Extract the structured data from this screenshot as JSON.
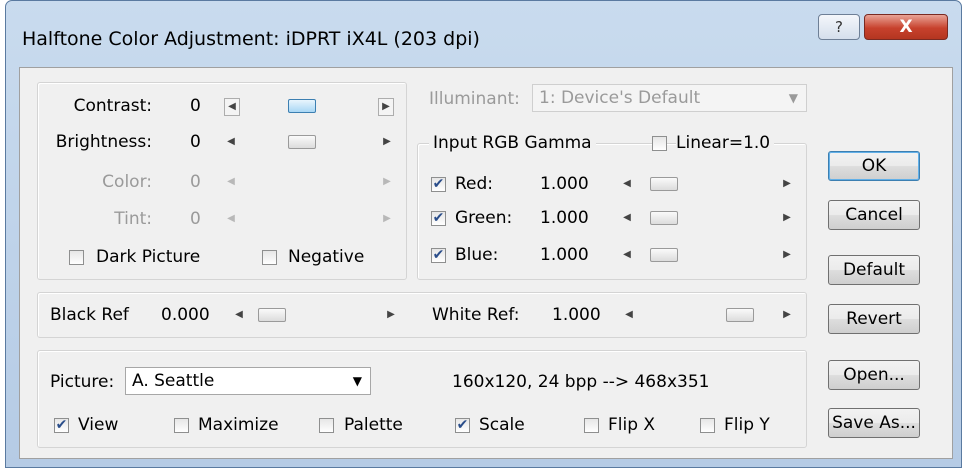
{
  "window": {
    "title": "Halftone Color Adjustment: iDPRT iX4L (203 dpi)",
    "help_glyph": "?",
    "close_glyph": "X"
  },
  "tone": {
    "contrast": {
      "label": "Contrast:",
      "value": "0"
    },
    "brightness": {
      "label": "Brightness:",
      "value": "0"
    },
    "color": {
      "label": "Color:",
      "value": "0"
    },
    "tint": {
      "label": "Tint:",
      "value": "0"
    },
    "dark_picture": {
      "label": "Dark Picture",
      "checked": false
    },
    "negative": {
      "label": "Negative",
      "checked": false
    }
  },
  "illuminant": {
    "label": "Illuminant:",
    "value": "1: Device's Default"
  },
  "gamma": {
    "title": "Input RGB Gamma",
    "linear": {
      "label": "Linear=1.0",
      "checked": false
    },
    "red": {
      "label": "Red:",
      "value": "1.000",
      "checked": true
    },
    "green": {
      "label": "Green:",
      "value": "1.000",
      "checked": true
    },
    "blue": {
      "label": "Blue:",
      "value": "1.000",
      "checked": true
    }
  },
  "reference": {
    "black": {
      "label": "Black Ref",
      "value": "0.000"
    },
    "white": {
      "label": "White Ref:",
      "value": "1.000"
    }
  },
  "picture": {
    "label": "Picture:",
    "selected": "A. Seattle",
    "info": "160x120, 24 bpp  --> 468x351",
    "view": {
      "label": "View",
      "checked": true
    },
    "maximize": {
      "label": "Maximize",
      "checked": false
    },
    "palette": {
      "label": "Palette",
      "checked": false
    },
    "scale": {
      "label": "Scale",
      "checked": true
    },
    "flip_x": {
      "label": "Flip X",
      "checked": false
    },
    "flip_y": {
      "label": "Flip Y",
      "checked": false
    }
  },
  "buttons": {
    "ok": "OK",
    "cancel": "Cancel",
    "default": "Default",
    "revert": "Revert",
    "open": "Open...",
    "save_as": "Save As..."
  },
  "glyphs": {
    "check": "✔",
    "left": "◀",
    "right": "▶",
    "down": "▼"
  },
  "colors": {
    "title_bar": "#c9dbee",
    "close_button": "#c7412d",
    "dialog_bg": "#f0f0f0"
  }
}
